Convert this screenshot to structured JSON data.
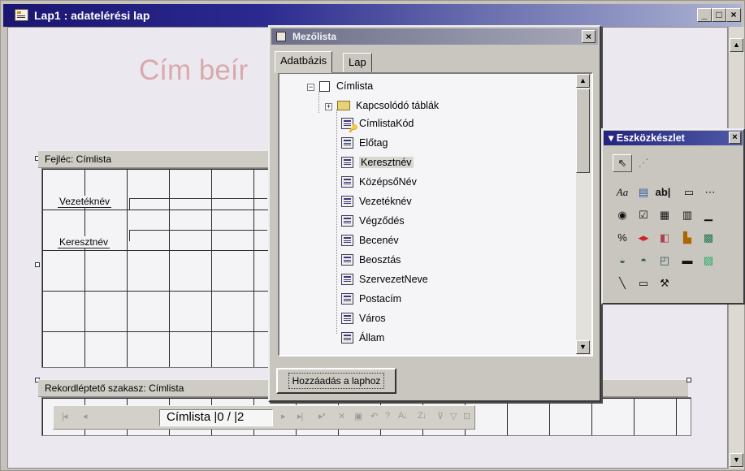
{
  "window": {
    "title": "Lap1 : adatelérési lap",
    "buttons": [
      "_",
      "□",
      "×"
    ]
  },
  "form": {
    "title_fragment": "Cím beír",
    "header_band": "Fejléc: Címlista",
    "labels": [
      "Vezetéknév",
      "Keresztnév"
    ],
    "navigation_band": "Rekordléptető szakasz: Címlista",
    "nav_field_text": "Címlista |0 / |2",
    "nav_arrows": [
      "|◂",
      "◂",
      "▸",
      "▸|",
      "▸*"
    ]
  },
  "field_list": {
    "title": "Mezőlista",
    "close": "×",
    "tabs": [
      "Adatbázis",
      "Lap"
    ],
    "root": "Címlista",
    "related": "Kapcsolódó táblák",
    "fields": [
      "CímlistaKód",
      "Előtag",
      "Keresztnév",
      "KözépsőNév",
      "Vezetéknév",
      "Végződés",
      "Becenév",
      "Beosztás",
      "SzervezetNeve",
      "Postacím",
      "Város",
      "Állam"
    ],
    "selected_field": "Keresztnév",
    "add_button": "Hozzáadás a laphoz"
  },
  "toolbox": {
    "title": "Eszközkészlet",
    "close": "×",
    "tools": [
      "pointer-icon",
      "wizard-icon",
      "label-icon",
      "textbox-icon",
      "textbox-ab-icon",
      "button-icon",
      "ellipsis-icon",
      "option-icon",
      "checkbox-icon",
      "dropdown-icon",
      "listbox-icon",
      "listbox2-icon",
      "hyperlink-icon",
      "spinner-icon",
      "pivot-icon",
      "chart-icon",
      "spreadsheet-icon",
      "record-icon",
      "record2-icon",
      "record3-icon",
      "video-icon",
      "image-icon",
      "line-icon",
      "rectangle-icon",
      "more-tools-icon"
    ]
  }
}
